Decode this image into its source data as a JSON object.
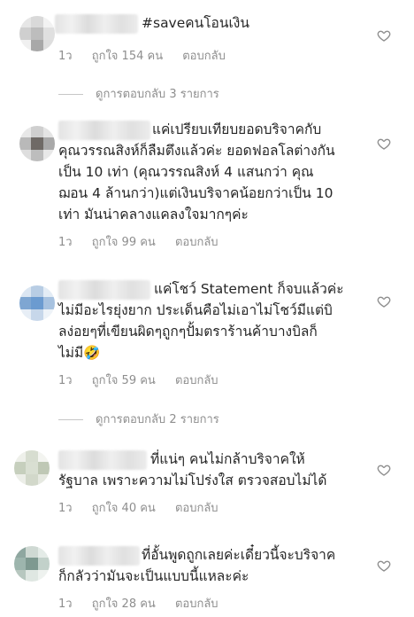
{
  "comments": [
    {
      "text_lines": [
        "#saveคนโอนเงิน"
      ],
      "time": "1ว",
      "likes": "ถูกใจ 154 คน",
      "reply": "ตอบกลับ",
      "avatar_colors": [
        "#e6e6e6",
        "#d9d9d9",
        "#f2f2f2",
        "#cfcfcf",
        "#bdbdbd",
        "#e0e0e0",
        "#f0f0f0",
        "#a8a8a8",
        "#dedede"
      ]
    },
    {
      "text_lines": [
        "แค่เปรียบเทียบยอดบริจาคกับ",
        "คุณวรรณสิงห์ก็ลืมตึงแล้วค่ะ ยอดฟอลโลต่างกัน",
        "เป็น 10 เท่า (คุณวรรณสิงห์ 4 แสนกว่า คุณ",
        "ฌอน 4 ล้านกว่า)แต่เงินบริจาคน้อยกว่าเป็น 10",
        "เท่า มันน่าคลางแคลงใจมากๆค่ะ"
      ],
      "time": "1ว",
      "likes": "ถูกใจ 99 คน",
      "reply": "ตอบกลับ",
      "avatar_colors": [
        "#e8e8e8",
        "#cfcfcf",
        "#e4e4e4",
        "#b9b9b9",
        "#6f6a66",
        "#a9a9a9",
        "#dedede",
        "#bdbdbd",
        "#e8e8e8"
      ]
    },
    {
      "text_lines": [
        "แค่โชว์ Statement ก็จบแล้วค่ะ",
        "ไม่มีอะไรยุ่งยาก ประเด็นคือไม่เอาไม่โชว์มีแต่บิ",
        "ลง่อยๆที่เขียนผิดๆถูกๆปั้มตราร้านค้าบางบิลก็",
        "ไม่มี🤣"
      ],
      "time": "1ว",
      "likes": "ถูกใจ 59 คน",
      "reply": "ตอบกลับ",
      "avatar_colors": [
        "#dbe6f2",
        "#b8cde4",
        "#e3ecf5",
        "#7ea6d2",
        "#6b9bd0",
        "#a7c2e0",
        "#e7eef6",
        "#c7d7ea",
        "#eef3f8"
      ]
    },
    {
      "text_lines": [
        "ที่แน่ๆ คนไม่กล้าบริจาคให้",
        "รัฐบาล เพราะความไม่โปร่งใส ตรวจสอบไม่ได้"
      ],
      "time": "1ว",
      "likes": "ถูกใจ 40 คน",
      "reply": "ตอบกลับ",
      "avatar_colors": [
        "#eef0ea",
        "#d7ddd0",
        "#f3f4f0",
        "#c6cfbd",
        "#d9dfd2",
        "#bfc8b5",
        "#eceee8",
        "#d2d8ca",
        "#e6e9e1"
      ]
    },
    {
      "text_lines": [
        "ที่อั้นพูดถูกเลยค่ะเดี๋ยวนี้จะบริจาค",
        "ก็กลัวว่ามันจะเป็นแบบนี้แหละค่ะ"
      ],
      "time": "1ว",
      "likes": "ถูกใจ 28 คน",
      "reply": "ตอบกลับ",
      "avatar_colors": [
        "#8fa7a0",
        "#cfd9d3",
        "#e4ebe7",
        "#9db5ad",
        "#7e9990",
        "#c2d1ca",
        "#b7c7bf",
        "#dfe7e2",
        "#eef2ef"
      ]
    }
  ],
  "reply_threads": [
    "ดูการตอบกลับ 3 รายการ",
    "ดูการตอบกลับ 2 รายการ"
  ],
  "colors": {
    "text": "#262626",
    "meta": "#8e8e8e",
    "heart": "#8e8e8e"
  }
}
